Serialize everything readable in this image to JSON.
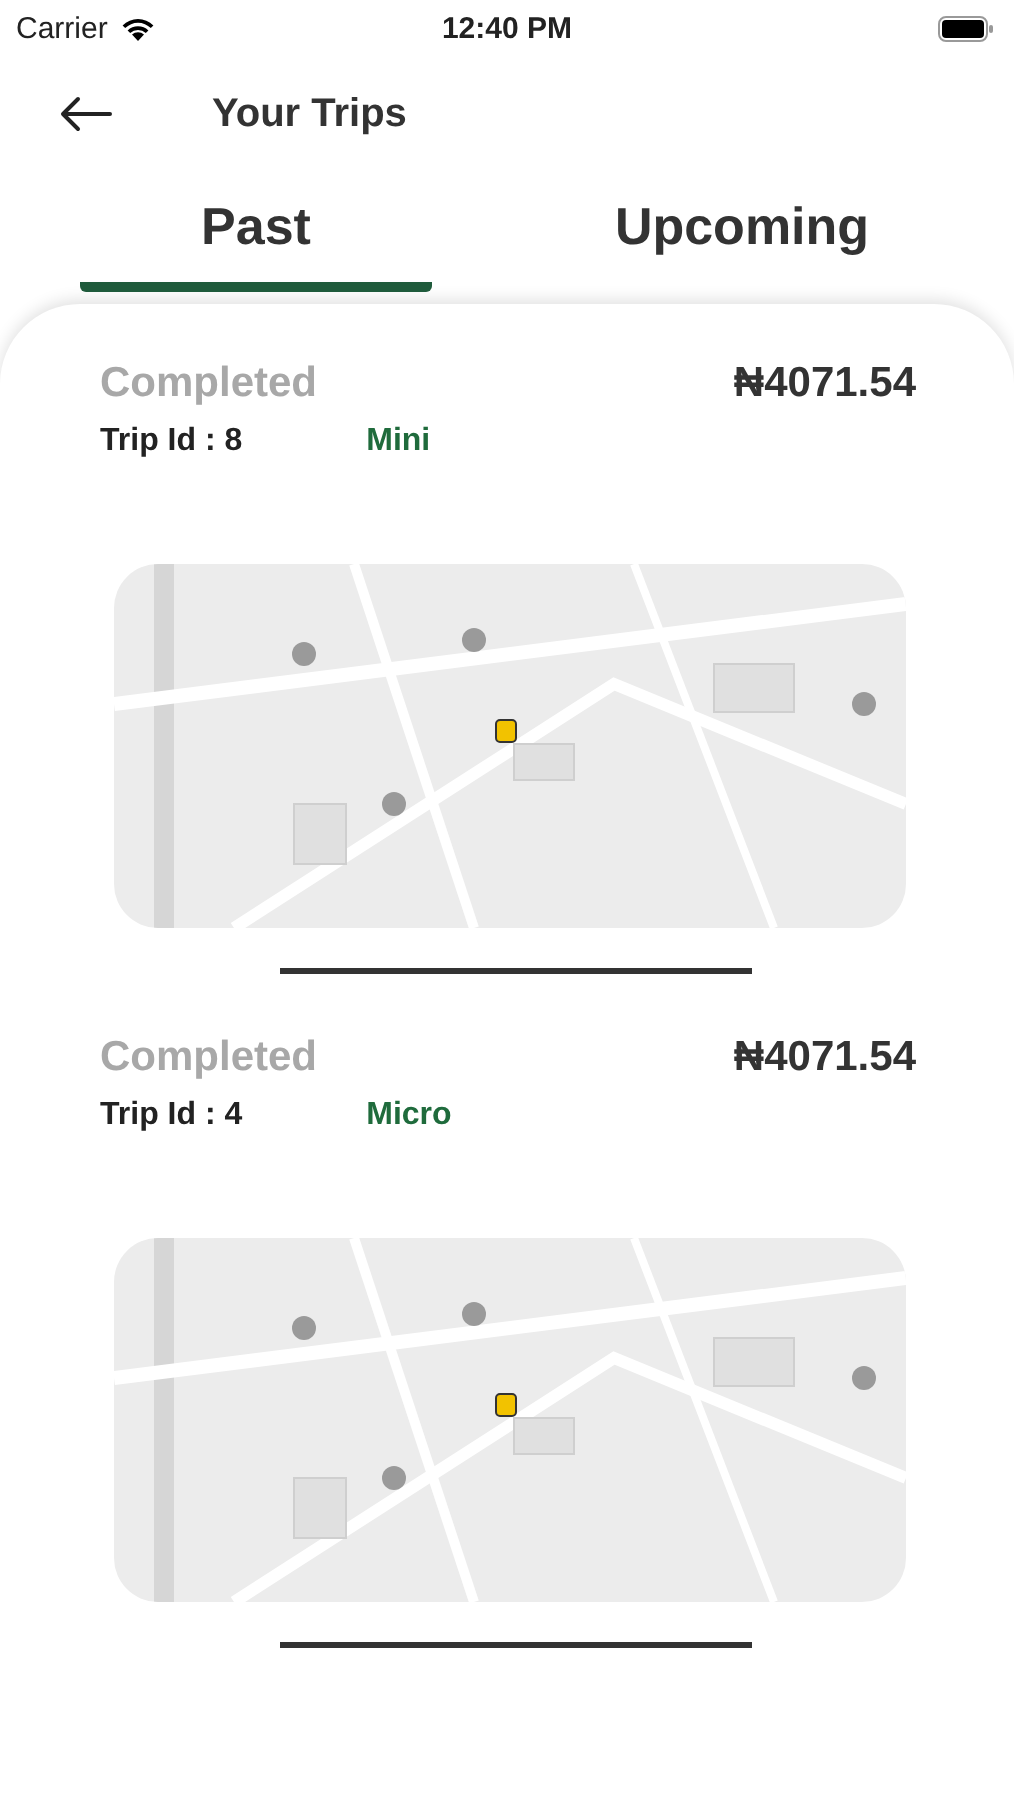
{
  "status_bar": {
    "carrier": "Carrier",
    "time": "12:40 PM"
  },
  "header": {
    "title": "Your Trips"
  },
  "tabs": [
    {
      "label": "Past",
      "selected": true
    },
    {
      "label": "Upcoming",
      "selected": false
    }
  ],
  "trips": [
    {
      "status": "Completed",
      "price": "₦4071.54",
      "trip_id": "Trip Id : 8",
      "vehicle": "Mini"
    },
    {
      "status": "Completed",
      "price": "₦4071.54",
      "trip_id": "Trip Id : 4",
      "vehicle": "Micro"
    }
  ]
}
